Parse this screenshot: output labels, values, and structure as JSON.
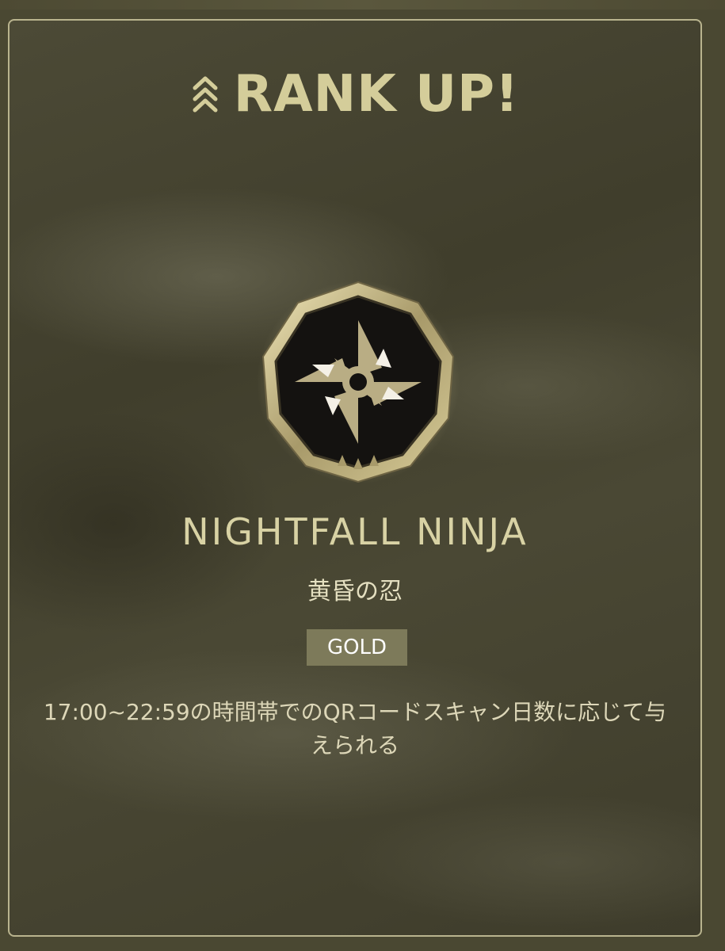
{
  "header": {
    "title": "RANK UP!",
    "icon": "triple-chevron-up-icon"
  },
  "badge": {
    "icon": "shuriken-badge-icon",
    "name": "NIGHTFALL NINJA",
    "name_jp": "黄昏の忍",
    "tier": "GOLD"
  },
  "description": "17:00~22:59の時間帯でのQRコードスキャン日数に応じて与えられる",
  "colors": {
    "accent": "#d4cd9a",
    "tier_bg": "#7d7a5a",
    "border": "#b9b48e"
  }
}
